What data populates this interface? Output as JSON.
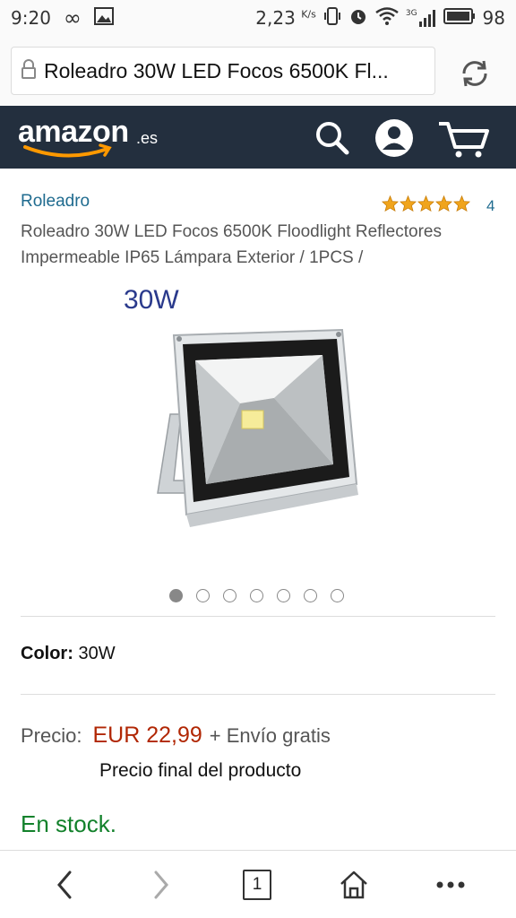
{
  "status_bar": {
    "time": "9:20",
    "speed_value": "2,23",
    "speed_unit": "K/s",
    "network": "3G",
    "battery": "98"
  },
  "url_bar": {
    "url_text": "Roleadro 30W LED Focos 6500K Fl..."
  },
  "header": {
    "logo_text": "amazon",
    "logo_suffix": ".es"
  },
  "product": {
    "brand": "Roleadro",
    "rating": 5,
    "rating_count": "4",
    "title": "Roleadro 30W LED Focos 6500K Floodlight Reflectores Impermeable IP65 Lámpara Exterior / 1PCS /",
    "image_label": "30W",
    "image_count": 7,
    "active_image_index": 0,
    "color_label": "Color:",
    "color_value": "30W",
    "price_label": "Precio:",
    "price_value": "EUR 22,99",
    "shipping": "+ Envío gratis",
    "final_note": "Precio final del producto",
    "stock": "En stock."
  },
  "colors": {
    "header_bg": "#232f3e",
    "brand_link": "#1f6b8f",
    "price": "#b12704",
    "stock": "#12812b",
    "star": "#f0a41c"
  },
  "bottom_nav": {
    "tab_count": "1"
  }
}
